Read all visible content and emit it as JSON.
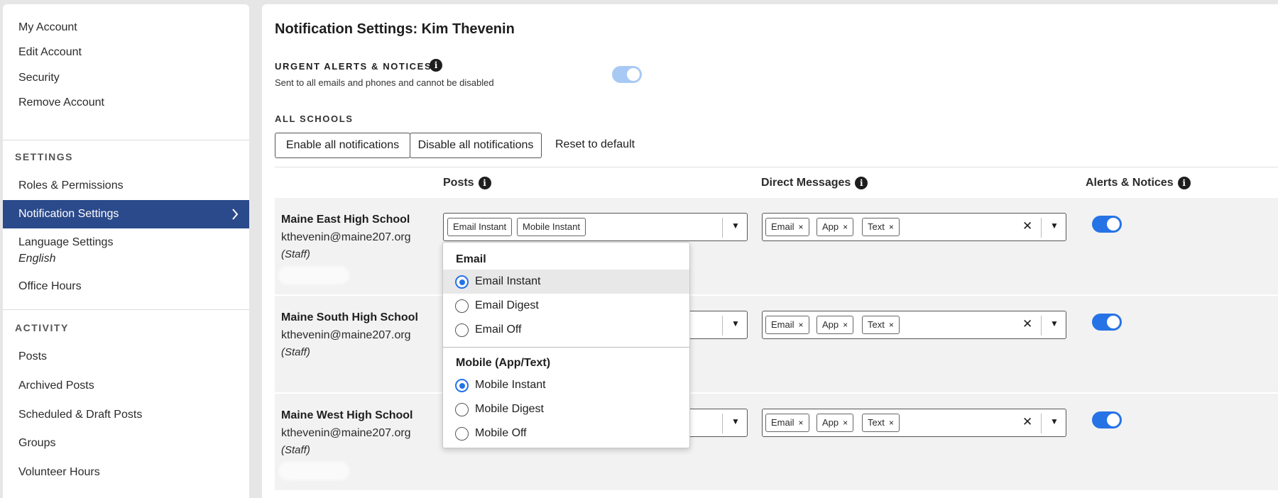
{
  "sidebar": {
    "account_items": [
      "My Account",
      "Edit Account",
      "Security",
      "Remove Account"
    ],
    "settings_heading": "SETTINGS",
    "settings_items": [
      "Roles & Permissions",
      "Notification Settings",
      "Language Settings",
      "Office Hours"
    ],
    "language_value": "English",
    "activity_heading": "ACTIVITY",
    "activity_items": [
      "Posts",
      "Archived Posts",
      "Scheduled & Draft Posts",
      "Groups",
      "Volunteer Hours"
    ]
  },
  "main": {
    "title": "Notification Settings: Kim Thevenin",
    "urgent": {
      "label": "URGENT ALERTS & NOTICES",
      "description": "Sent to all emails and phones and cannot be disabled",
      "toggle_on": true
    },
    "all_schools_label": "ALL SCHOOLS",
    "enable_all": "Enable all notifications",
    "disable_all": "Disable all notifications",
    "reset_default": "Reset to default",
    "columns": {
      "posts": "Posts",
      "direct_messages": "Direct Messages",
      "alerts": "Alerts & Notices"
    },
    "schools": [
      {
        "name": "Maine East High School",
        "email": "kthevenin@maine207.org",
        "role": "(Staff)",
        "posts": [
          "Email Instant",
          "Mobile Instant"
        ],
        "dm": [
          "Email",
          "App",
          "Text"
        ],
        "alerts_on": true
      },
      {
        "name": "Maine South High School",
        "email": "kthevenin@maine207.org",
        "role": "(Staff)",
        "dm": [
          "Email",
          "App",
          "Text"
        ],
        "alerts_on": true
      },
      {
        "name": "Maine West High School",
        "email": "kthevenin@maine207.org",
        "role": "(Staff)",
        "dm": [
          "Email",
          "App",
          "Text"
        ],
        "alerts_on": true
      }
    ],
    "dropdown": {
      "email_heading": "Email",
      "email_options": [
        "Email Instant",
        "Email Digest",
        "Email Off"
      ],
      "email_selected": "Email Instant",
      "mobile_heading": "Mobile (App/Text)",
      "mobile_options": [
        "Mobile Instant",
        "Mobile Digest",
        "Mobile Off"
      ],
      "mobile_selected": "Mobile Instant"
    },
    "chip_remove_symbol": "×",
    "clear_symbol": "✕",
    "arrow_symbol": "▼"
  },
  "colors": {
    "accent": "#2673e6",
    "sidebar_active": "#2b4a8b",
    "row_bg": "#f2f2f2"
  },
  "icons": {
    "info": "info-icon",
    "chevron": "chevron-right-icon",
    "dropdown": "caret-down-icon",
    "clear": "close-icon"
  }
}
